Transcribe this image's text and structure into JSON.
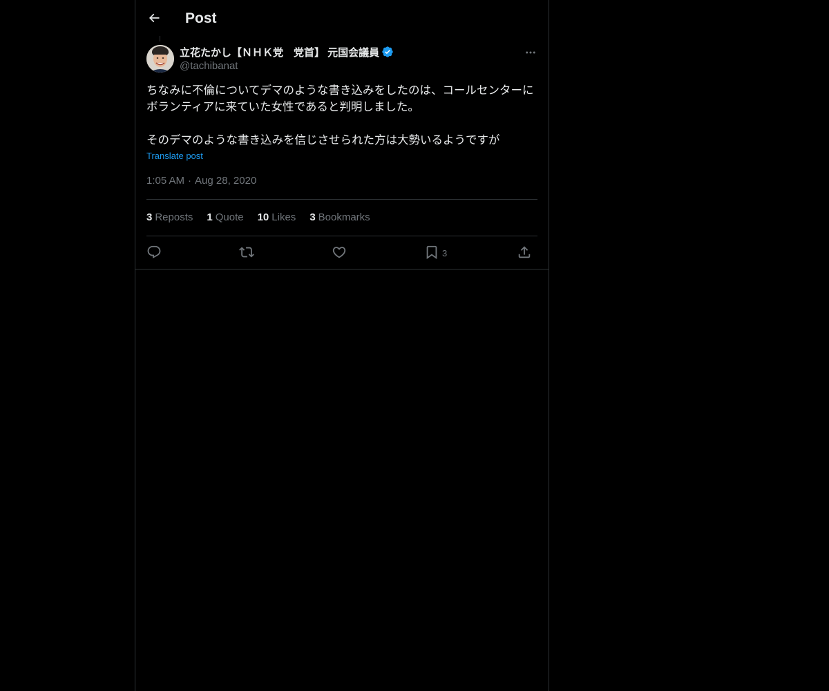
{
  "header": {
    "title": "Post",
    "back_icon": "arrow-left-icon"
  },
  "tweet": {
    "author_name": "立花たかし【ＮＨＫ党　党首】 元国会議員",
    "author_handle": "@tachibanat",
    "verified": true,
    "text": "ちなみに不倫についてデマのような書き込みをしたのは、コールセンターにボランティアに来ていた女性であると判明しました。\n\nそのデマのような書き込みを信じさせられた方は大勢いるようですが",
    "translate_label": "Translate post",
    "time": "1:05 AM",
    "separator": "·",
    "date": "Aug 28, 2020"
  },
  "stats": {
    "reposts_count": "3",
    "reposts_label": "Reposts",
    "quotes_count": "1",
    "quotes_label": "Quote",
    "likes_count": "10",
    "likes_label": "Likes",
    "bookmarks_count": "3",
    "bookmarks_label": "Bookmarks"
  },
  "actions": {
    "reply_icon": "reply-icon",
    "repost_icon": "repost-icon",
    "like_icon": "heart-icon",
    "bookmark_icon": "bookmark-icon",
    "bookmark_count": "3",
    "share_icon": "share-icon"
  },
  "colors": {
    "background": "#000000",
    "text_primary": "#e7e9ea",
    "text_secondary": "#71767b",
    "accent": "#1d9bf0",
    "border": "#2f3336"
  }
}
